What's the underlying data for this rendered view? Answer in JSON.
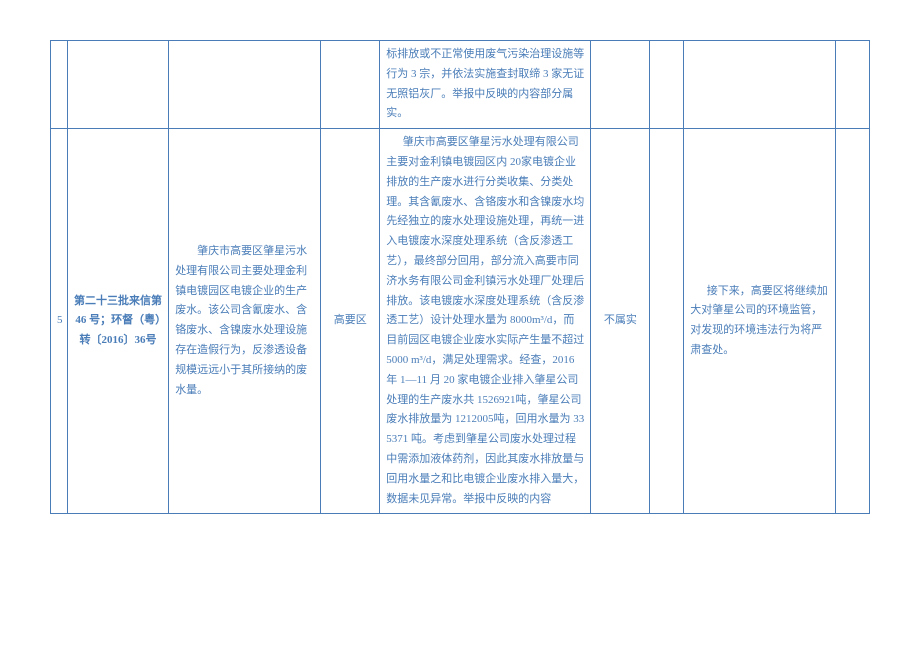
{
  "table": {
    "rows": [
      {
        "c0": "",
        "c1": "",
        "c2": "",
        "c3": "",
        "c4": "标排放或不正常使用废气污染治理设施等行为 3 宗，并依法实施查封取缔 3 家无证无照铝灰厂。举报中反映的内容部分属实。",
        "c5": "",
        "c6": "",
        "c7": "",
        "c8": ""
      },
      {
        "c0": "5",
        "c1": "第二十三批来信第 46 号；环督（粤）转〔2016〕36号",
        "c2": "　　肇庆市高要区肇星污水处理有限公司主要处理金利镇电镀园区电镀企业的生产废水。该公司含氰废水、含铬废水、含镍废水处理设施存在造假行为，反渗透设备规模远远小于其所接纳的废水量。",
        "c3": "高要区",
        "c4": "肇庆市高要区肇星污水处理有限公司主要对金利镇电镀园区内 20家电镀企业排放的生产废水进行分类收集、分类处理。其含氰废水、含铬废水和含镍废水均先经独立的废水处理设施处理，再统一进入电镀废水深度处理系统（含反渗透工艺），最终部分回用，部分流入高要市同济水务有限公司金利镇污水处理厂处理后排放。该电镀废水深度处理系统（含反渗透工艺）设计处理水量为 8000m³/d，而目前园区电镀企业废水实际产生量不超过 5000 m³/d，满足处理需求。经查，2016年 1—11 月 20 家电镀企业排入肇星公司处理的生产废水共 1526921吨，肇星公司废水排放量为 1212005吨，回用水量为 335371 吨。考虑到肇星公司废水处理过程中需添加液体药剂，因此其废水排放量与回用水量之和比电镀企业废水排入量大，数据未见异常。举报中反映的内容",
        "c5": "不属实",
        "c6": "",
        "c7": "接下来，高要区将继续加大对肇星公司的环境监管，对发现的环境违法行为将严肃查处。",
        "c8": ""
      }
    ]
  }
}
